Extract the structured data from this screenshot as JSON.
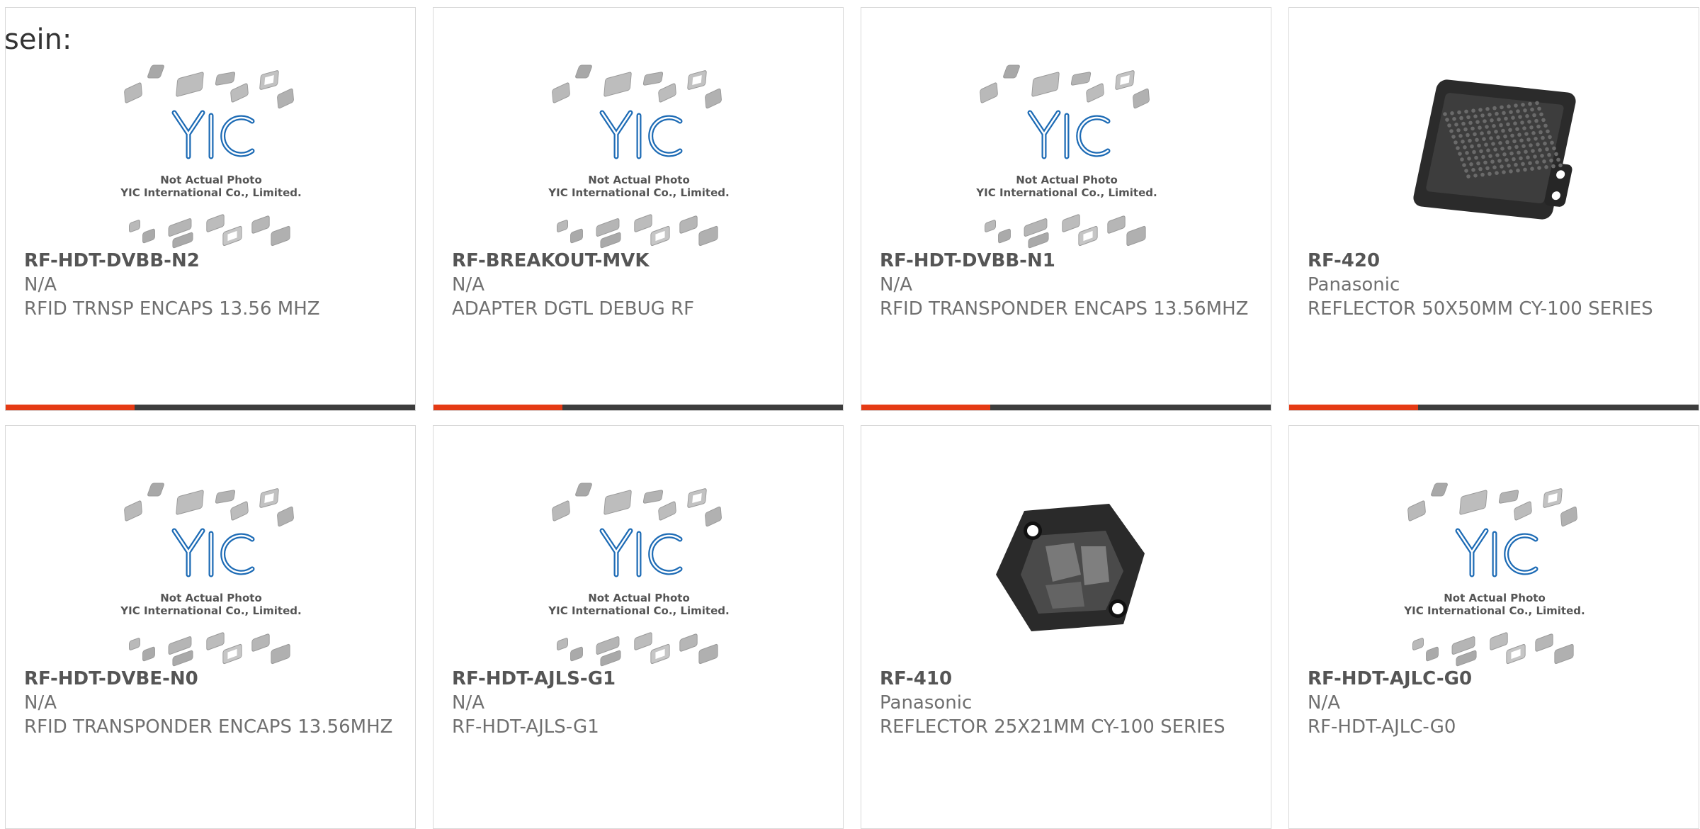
{
  "heading": "sein:",
  "placeholder": {
    "logo": "YIC",
    "line1": "Not Actual Photo",
    "line2": "YIC International Co., Limited."
  },
  "colors": {
    "accent": "#e53a14",
    "bar": "#3d3d3d",
    "logo_blue": "#1d6bb5"
  },
  "products": [
    {
      "part": "RF-HDT-DVBB-N2",
      "mfr": "N/A",
      "desc": "RFID TRNSP ENCAPS 13.56 MHZ",
      "image": "placeholder",
      "accent_bar": true
    },
    {
      "part": "RF-BREAKOUT-MVK",
      "mfr": "N/A",
      "desc": "ADAPTER DGTL DEBUG RF",
      "image": "placeholder",
      "accent_bar": true
    },
    {
      "part": "RF-HDT-DVBB-N1",
      "mfr": "N/A",
      "desc": "RFID TRANSPONDER ENCAPS 13.56MHZ",
      "image": "placeholder",
      "accent_bar": true
    },
    {
      "part": "RF-420",
      "mfr": "Panasonic",
      "desc": "REFLECTOR 50X50MM CY-100 SERIES",
      "image": "reflector-square",
      "accent_bar": true
    },
    {
      "part": "RF-HDT-DVBE-N0",
      "mfr": "N/A",
      "desc": "RFID TRANSPONDER ENCAPS 13.56MHZ",
      "image": "placeholder",
      "accent_bar": false
    },
    {
      "part": "RF-HDT-AJLS-G1",
      "mfr": "N/A",
      "desc": "RF-HDT-AJLS-G1",
      "image": "placeholder",
      "accent_bar": false
    },
    {
      "part": "RF-410",
      "mfr": "Panasonic",
      "desc": "REFLECTOR 25X21MM CY-100 SERIES",
      "image": "reflector-hex",
      "accent_bar": false
    },
    {
      "part": "RF-HDT-AJLC-G0",
      "mfr": "N/A",
      "desc": "RF-HDT-AJLC-G0",
      "image": "placeholder",
      "accent_bar": false
    }
  ]
}
